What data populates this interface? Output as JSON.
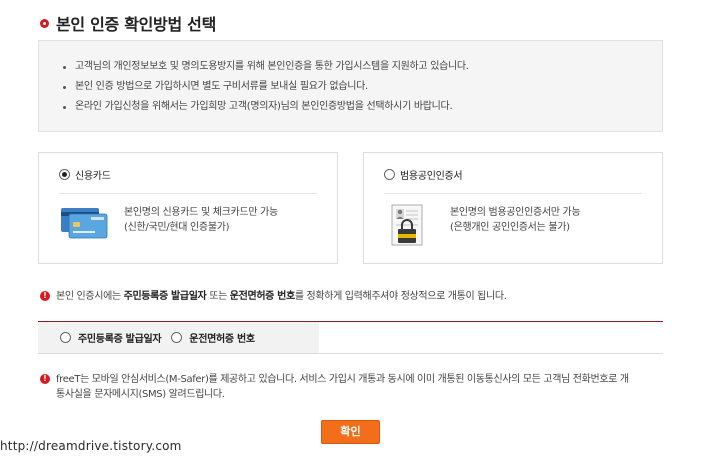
{
  "title": "본인 인증 확인방법 선택",
  "notice": [
    "고객님의 개인정보보호 및 명의도용방지를 위해 본인인증을 통한 가입시스템을 지원하고 있습니다.",
    "본인 인증 방법으로 가입하시면 별도 구비서류를 보내실 필요가 없습니다.",
    "온라인 가입신청을 위해서는 가입희망 고객(명의자)님의 본인인증방법을 선택하시기 바랍니다."
  ],
  "methods": {
    "card": {
      "label": "신용카드",
      "selected": true,
      "desc1": "본인명의 신용카드 및 체크카드만 가능",
      "desc2": "(신한/국민/현대 인증불가)",
      "icon": "credit-card-icon"
    },
    "cert": {
      "label": "범용공인인증서",
      "selected": false,
      "desc1": "본인명의 범용공인인증서만 가능",
      "desc2": "(은행개인 공인인증서는 불가)",
      "icon": "certificate-icon"
    }
  },
  "warning1": {
    "prefix": "본인 인증시에는 ",
    "bold1": "주민등록증 발급일자",
    "mid": " 또는 ",
    "bold2": "운전면허증 번호",
    "suffix": "를 정확하게 입력해주셔야 정상적으로 개통이 됩니다."
  },
  "id_options": {
    "option1": "주민등록증 발급일자",
    "option2": "운전면허증 번호"
  },
  "warning2": {
    "line1": "freeT는 모바일 안심서비스(M-Safer)를 제공하고 있습니다. 서비스 가입시 개통과 동시에 이미 개통된 이동통신사의 모든 고객님 전화번호로 개",
    "line2": "통사실을 문자메시지(SMS) 알려드립니다."
  },
  "confirm_label": "확인",
  "watermark": "http://dreamdrive.tistory.com",
  "colors": {
    "accent_red": "#d71920",
    "divider_red": "#8e1b1f",
    "button_orange": "#f36e1a"
  }
}
